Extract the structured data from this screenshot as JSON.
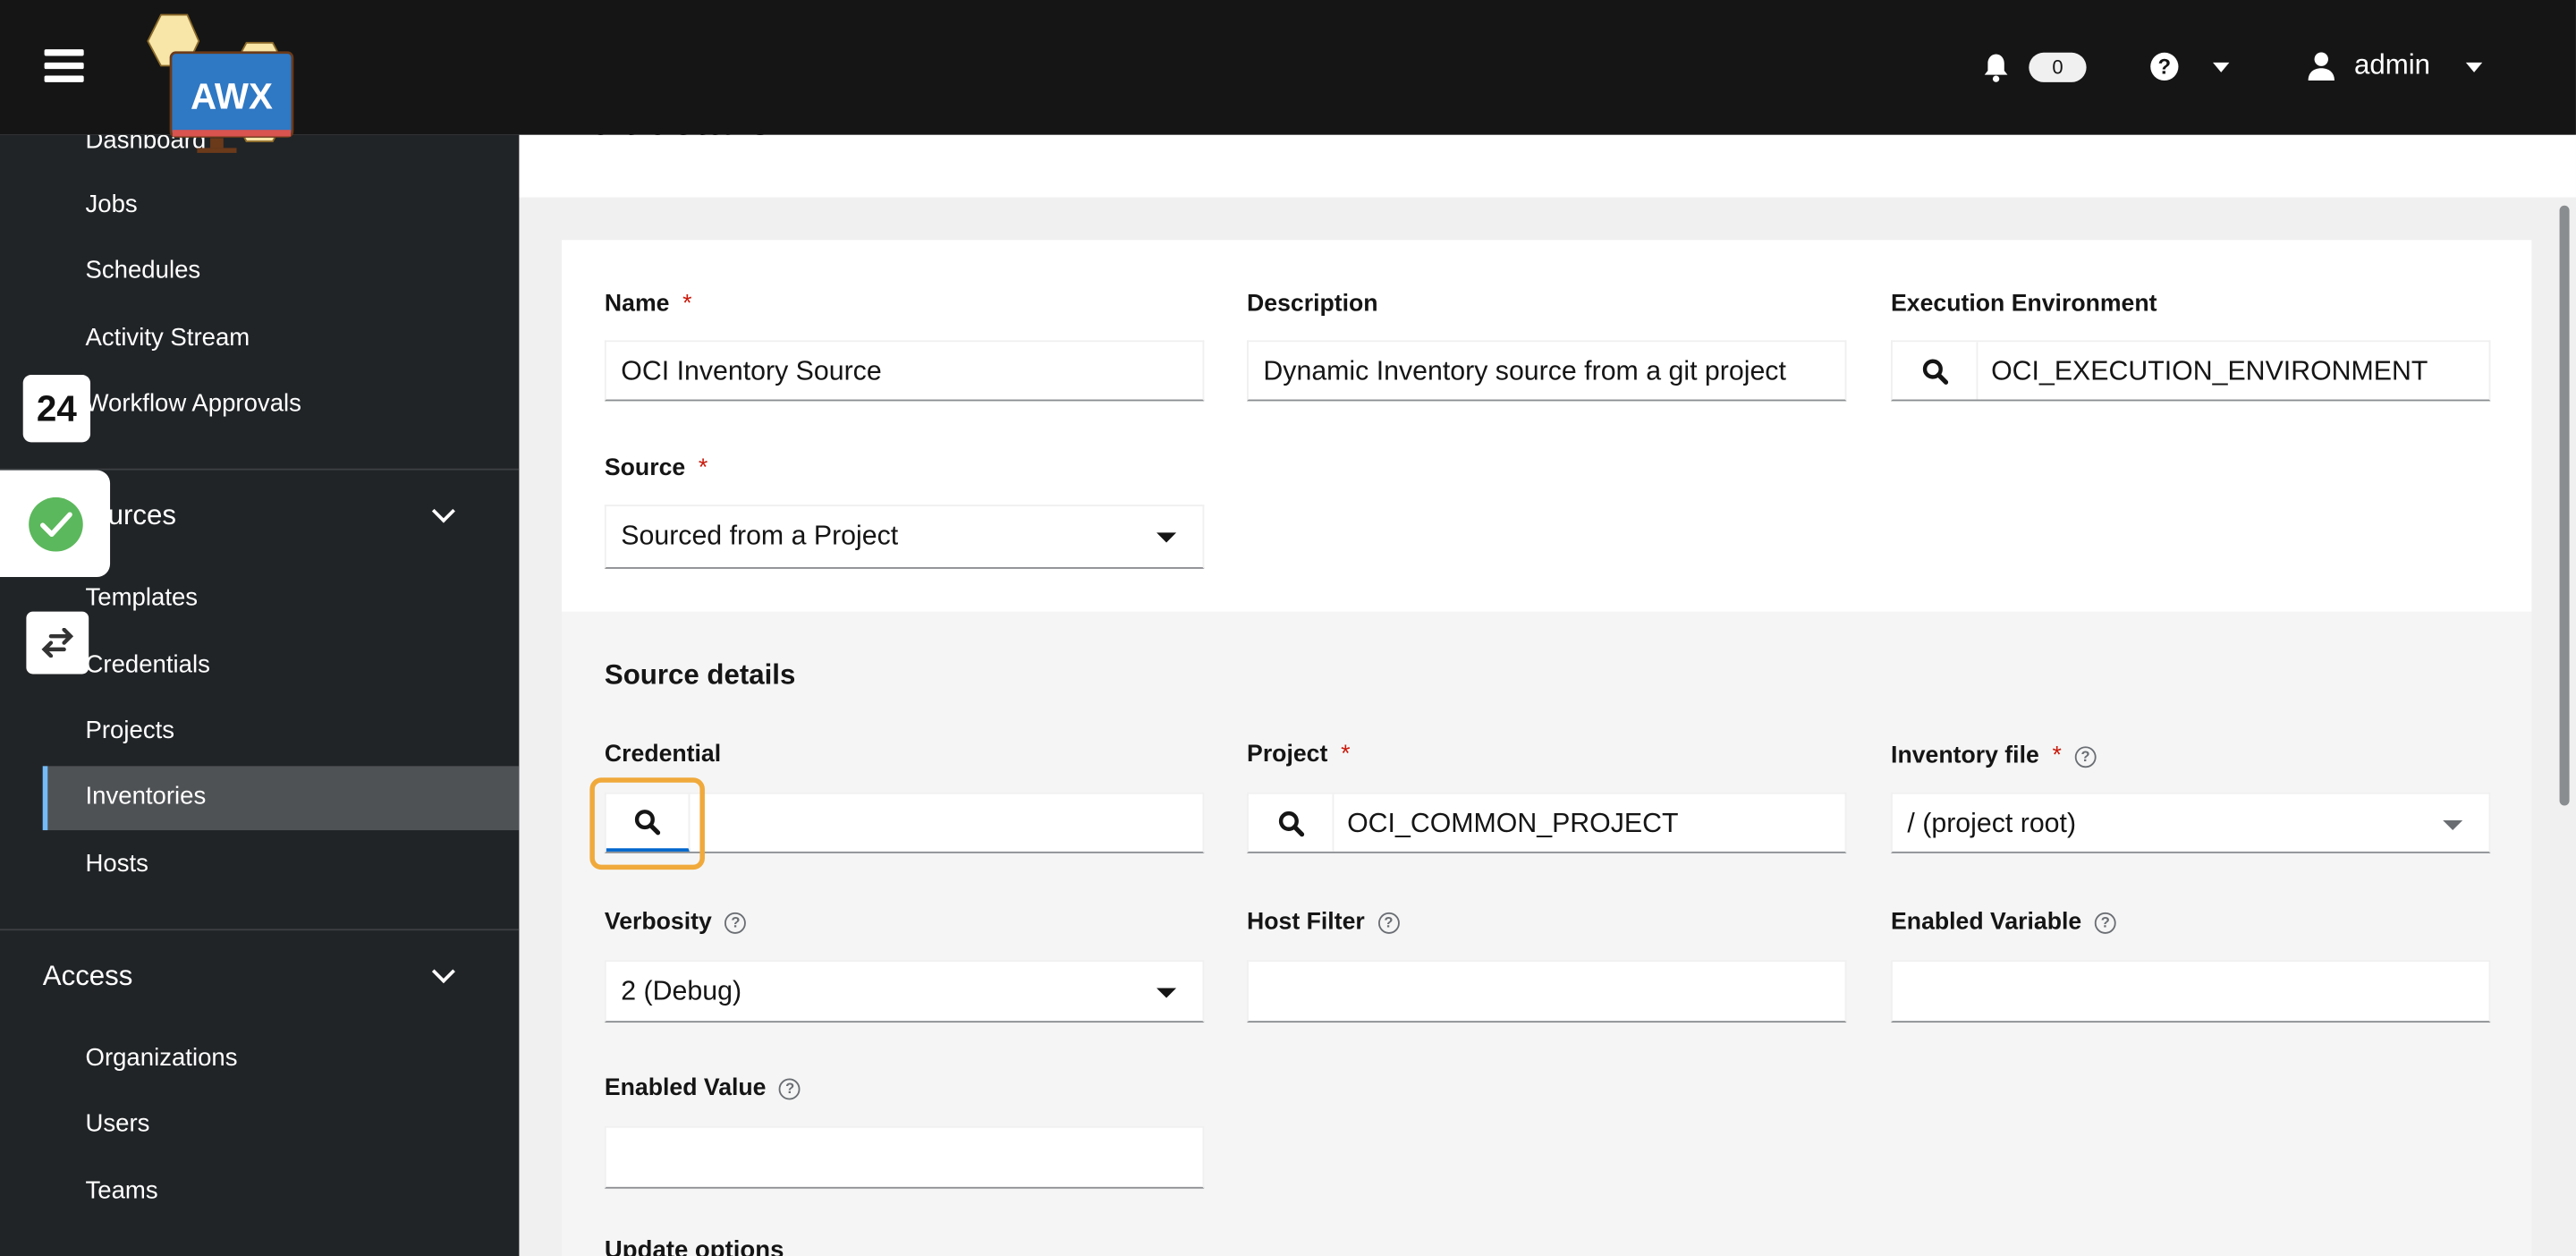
{
  "header": {
    "notification_count": "0",
    "user": "admin",
    "logo_text": "AWX"
  },
  "sidebar": {
    "items_top": [
      {
        "label": "Dashboard"
      },
      {
        "label": "Jobs"
      },
      {
        "label": "Schedules"
      },
      {
        "label": "Activity Stream"
      },
      {
        "label": "Workflow Approvals"
      }
    ],
    "resources": {
      "label": "Resources",
      "visible_label": "urces",
      "items": [
        {
          "label": "Templates"
        },
        {
          "label": "Credentials"
        },
        {
          "label": "Projects"
        },
        {
          "label": "Inventories",
          "selected": true
        },
        {
          "label": "Hosts"
        }
      ]
    },
    "access": {
      "label": "Access",
      "items": [
        {
          "label": "Organizations"
        },
        {
          "label": "Users"
        },
        {
          "label": "Teams"
        }
      ]
    }
  },
  "overlays": {
    "badge_number": "24",
    "check_color": "#5cb85c"
  },
  "page": {
    "title": "Edit details"
  },
  "form": {
    "name": {
      "label": "Name",
      "value": "OCI Inventory Source"
    },
    "description": {
      "label": "Description",
      "value": "Dynamic Inventory source from a git project"
    },
    "execution_environment": {
      "label": "Execution Environment",
      "value": "OCI_EXECUTION_ENVIRONMENT"
    },
    "source": {
      "label": "Source",
      "value": "Sourced from a Project"
    },
    "source_details_heading": "Source details",
    "credential": {
      "label": "Credential",
      "value": ""
    },
    "project": {
      "label": "Project",
      "value": "OCI_COMMON_PROJECT"
    },
    "inventory_file": {
      "label": "Inventory file",
      "value": "/ (project root)"
    },
    "verbosity": {
      "label": "Verbosity",
      "value": "2 (Debug)"
    },
    "host_filter": {
      "label": "Host Filter",
      "value": ""
    },
    "enabled_variable": {
      "label": "Enabled Variable",
      "value": ""
    },
    "enabled_value": {
      "label": "Enabled Value",
      "value": ""
    },
    "update_options_heading": "Update options"
  },
  "colors": {
    "focus_highlight": "#f0a93b",
    "selected_bar": "#73bcf7",
    "required": "#c9190b"
  }
}
